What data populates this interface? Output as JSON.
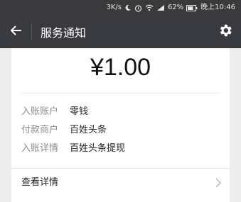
{
  "status_bar": {
    "net_speed": "3K/s",
    "battery": "62%",
    "time": "晚上10:46"
  },
  "header": {
    "title": "服务通知",
    "icons": {
      "back": "back-arrow-icon",
      "settings": "gear-icon"
    }
  },
  "notice": {
    "amount": "¥1.00",
    "rows": [
      {
        "label": "入账账户",
        "value": "零钱"
      },
      {
        "label": "付款商户",
        "value": "百姓头条"
      },
      {
        "label": "入账详情",
        "value": "百姓头条提现"
      }
    ],
    "detail_link": "查看详情"
  },
  "colors": {
    "app_bar": "#393a3f",
    "status_bar": "#3a3a3c",
    "background": "#ededed",
    "card": "#ffffff"
  }
}
